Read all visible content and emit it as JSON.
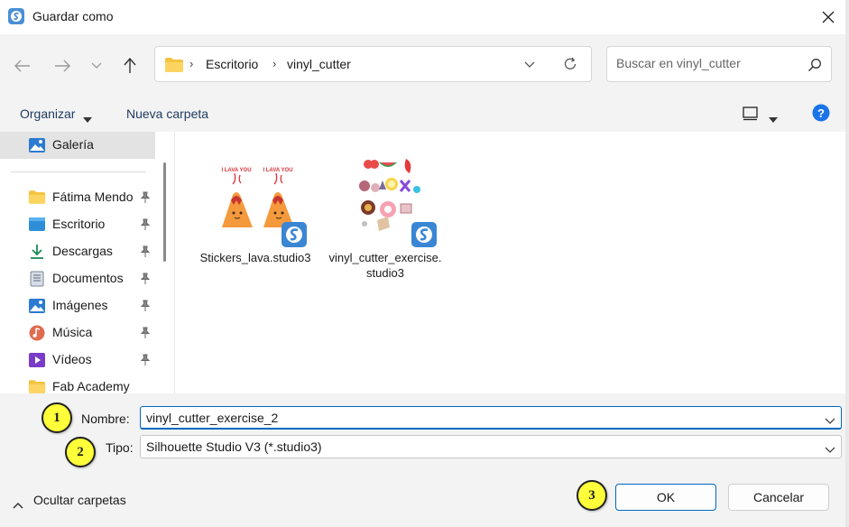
{
  "window": {
    "title": "Guardar como",
    "app_icon": "silhouette-app-icon",
    "close_icon": "close-icon"
  },
  "nav": {
    "back_icon": "arrow-left-icon",
    "forward_icon": "arrow-right-icon",
    "recent_icon": "chevron-down-icon",
    "up_icon": "arrow-up-icon",
    "breadcrumb": [
      "Escritorio",
      "vinyl_cutter"
    ],
    "search_placeholder": "Buscar en vinyl_cutter"
  },
  "commands": {
    "organize": "Organizar",
    "new_folder": "Nueva carpeta"
  },
  "sidebar": {
    "items": [
      {
        "label": "Galería",
        "icon": "gallery-icon",
        "pinned": false,
        "selected": true
      },
      {
        "label": "Fátima Mendo",
        "icon": "folder-icon",
        "pinned": true
      },
      {
        "label": "Escritorio",
        "icon": "desktop-icon",
        "pinned": true
      },
      {
        "label": "Descargas",
        "icon": "download-icon",
        "pinned": true
      },
      {
        "label": "Documentos",
        "icon": "documents-icon",
        "pinned": true
      },
      {
        "label": "Imágenes",
        "icon": "pictures-icon",
        "pinned": true
      },
      {
        "label": "Música",
        "icon": "music-icon",
        "pinned": true
      },
      {
        "label": "Vídeos",
        "icon": "videos-icon",
        "pinned": true
      },
      {
        "label": "Fab Academy",
        "icon": "folder-icon",
        "pinned": false
      }
    ]
  },
  "files": [
    {
      "name": "Stickers_lava.studio3",
      "thumb_caption": "I LAVA YOU"
    },
    {
      "name": "vinyl_cutter_exercise.studio3"
    }
  ],
  "form": {
    "name_label": "Nombre:",
    "name_value": "vinyl_cutter_exercise_2",
    "type_label": "Tipo:",
    "type_value": "Silhouette Studio V3 (*.studio3)"
  },
  "annotations": [
    "1",
    "2",
    "3"
  ],
  "footer": {
    "hide_folders": "Ocultar carpetas",
    "ok": "OK",
    "cancel": "Cancelar"
  },
  "colors": {
    "accent": "#0067c0",
    "folder": "#f5c342",
    "annotation": "#ffff3a",
    "app_badge": "#3a86d4"
  }
}
